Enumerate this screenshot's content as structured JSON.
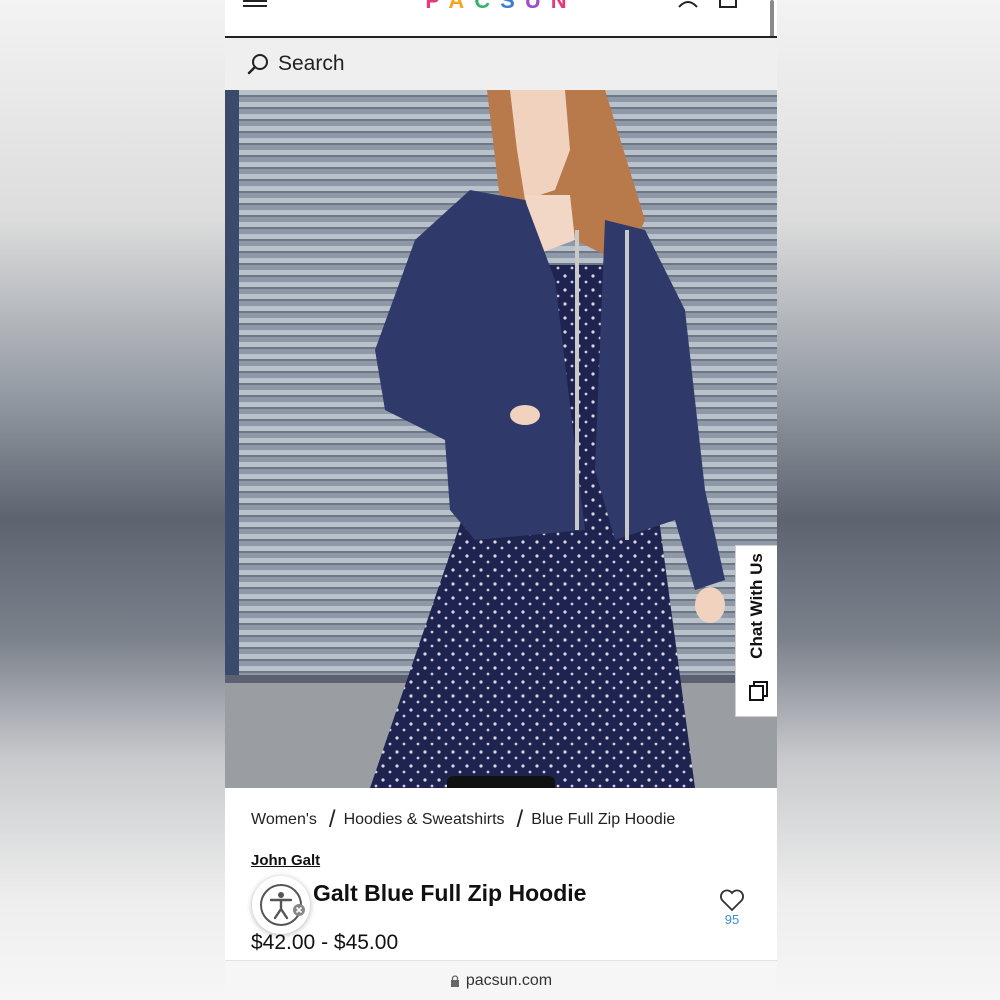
{
  "header": {
    "logo_letters": [
      "P",
      "A",
      "C",
      "S",
      "U",
      "N"
    ]
  },
  "search": {
    "label": "Search"
  },
  "chat": {
    "label": "Chat With Us"
  },
  "breadcrumb": [
    {
      "label": "Women's"
    },
    {
      "label": "Hoodies & Sweatshirts"
    },
    {
      "label": "Blue Full Zip Hoodie"
    }
  ],
  "product": {
    "brand": "John Galt",
    "title": "Galt Blue Full Zip Hoodie",
    "price": "$42.00 - $45.00",
    "likes": "95"
  },
  "browser": {
    "url": "pacsun.com"
  },
  "colors": {
    "accent_blue": "#3a8fd6",
    "hoodie": "#2f3a6b",
    "dress": "#1f2350"
  }
}
